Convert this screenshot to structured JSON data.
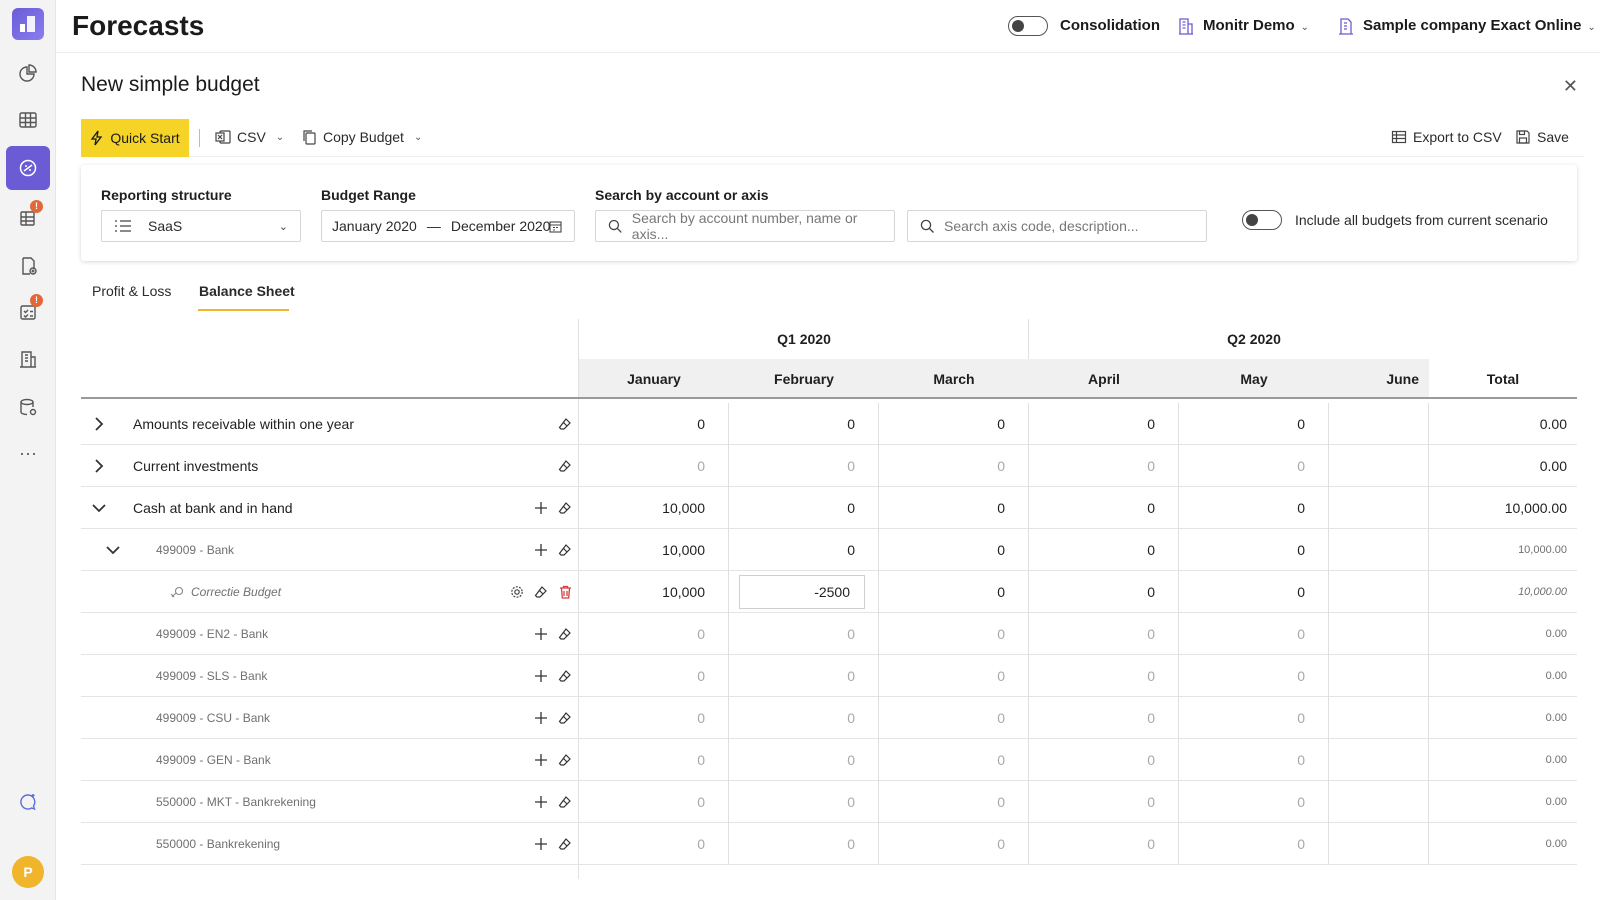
{
  "app": {
    "title": "Forecasts",
    "consolidation_label": "Consolidation",
    "org": "Monitr Demo",
    "company": "Sample company Exact Online",
    "avatar_initial": "P"
  },
  "sidebar": {
    "items": [
      {
        "icon": "pie-chart-icon"
      },
      {
        "icon": "grid-icon"
      },
      {
        "icon": "forecast-icon",
        "active": true
      },
      {
        "icon": "table-alert-icon",
        "badge": "!"
      },
      {
        "icon": "report-add-icon"
      },
      {
        "icon": "checklist-alert-icon",
        "badge": "!"
      },
      {
        "icon": "building-icon"
      },
      {
        "icon": "database-icon"
      },
      {
        "icon": "more-icon",
        "label": "···"
      }
    ]
  },
  "panel": {
    "title": "New simple budget",
    "toolbar": {
      "quick_start": "Quick Start",
      "csv": "CSV",
      "copy_budget": "Copy Budget",
      "export_csv": "Export to CSV",
      "save": "Save"
    },
    "filters": {
      "reporting_label": "Reporting structure",
      "reporting_value": "SaaS",
      "range_label": "Budget Range",
      "range_from": "January 2020",
      "range_dash": "—",
      "range_to": "December 2020",
      "search_label": "Search by account or axis",
      "search_placeholder": "Search by account number, name or axis...",
      "axis_placeholder": "Search axis code, description...",
      "include_label": "Include all budgets from current scenario"
    },
    "tabs": [
      {
        "label": "Profit & Loss"
      },
      {
        "label": "Balance Sheet",
        "active": true
      }
    ]
  },
  "grid": {
    "quarters": [
      "Q1 2020",
      "Q2 2020"
    ],
    "months": [
      "January",
      "February",
      "March",
      "April",
      "May",
      "June"
    ],
    "total_header": "Total",
    "rows": [
      {
        "label": "Amounts receivable within one year",
        "values": [
          "0",
          "0",
          "0",
          "0",
          "0"
        ],
        "total": "0.00"
      },
      {
        "label": "Current investments",
        "values": [
          "0",
          "0",
          "0",
          "0",
          "0"
        ],
        "total": "0.00"
      },
      {
        "label": "Cash at bank and in hand",
        "values": [
          "10,000",
          "0",
          "0",
          "0",
          "0"
        ],
        "total": "10,000.00"
      },
      {
        "label": "499009 - Bank",
        "values": [
          "10,000",
          "0",
          "0",
          "0",
          "0"
        ],
        "total": "10,000.00"
      },
      {
        "label": "Correctie Budget",
        "values": [
          "10,000",
          "-2500",
          "0",
          "0",
          "0"
        ],
        "total": "10,000.00"
      },
      {
        "label": "499009 - EN2 - Bank",
        "values": [
          "0",
          "0",
          "0",
          "0",
          "0"
        ],
        "total": "0.00"
      },
      {
        "label": "499009 - SLS - Bank",
        "values": [
          "0",
          "0",
          "0",
          "0",
          "0"
        ],
        "total": "0.00"
      },
      {
        "label": "499009 - CSU - Bank",
        "values": [
          "0",
          "0",
          "0",
          "0",
          "0"
        ],
        "total": "0.00"
      },
      {
        "label": "499009 - GEN - Bank",
        "values": [
          "0",
          "0",
          "0",
          "0",
          "0"
        ],
        "total": "0.00"
      },
      {
        "label": "550000 - MKT - Bankrekening",
        "values": [
          "0",
          "0",
          "0",
          "0",
          "0"
        ],
        "total": "0.00"
      },
      {
        "label": "550000 - Bankrekening",
        "values": [
          "0",
          "0",
          "0",
          "0",
          "0"
        ],
        "total": "0.00"
      }
    ]
  }
}
